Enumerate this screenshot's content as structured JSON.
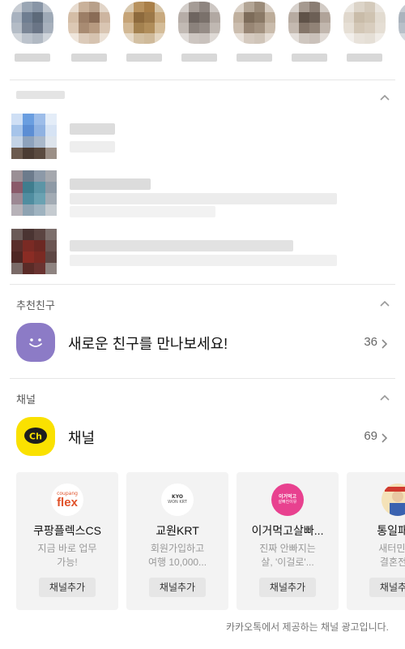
{
  "sections": {
    "birthday": {
      "title": "추천친구"
    },
    "recommended": {
      "title": "추천친구",
      "item_label": "새로운 친구를 만나보세요!",
      "count": "36",
      "icon": "smile-face-icon",
      "icon_color": "#8c7bc6"
    },
    "channels": {
      "title": "채널",
      "item_label": "채널",
      "count": "69",
      "icon": "kakao-channel-icon",
      "icon_color": "#fae100",
      "icon_text": "Ch"
    }
  },
  "channel_cards": [
    {
      "title": "쿠팡플렉스CS",
      "desc": "지금 바로 업무\n가능!",
      "button": "채널추가",
      "logo_top": "coupang",
      "logo_main": "flex"
    },
    {
      "title": "교원KRT",
      "desc": "회원가입하고\n여행 10,000...",
      "button": "채널추가",
      "logo_top": "KYO",
      "logo_main": "WON KRT"
    },
    {
      "title": "이거먹고살빠...",
      "desc": "진짜 안빠지는\n살, '이걸로'...",
      "button": "채널추가",
      "logo_top": "이거먹고",
      "logo_main": "살빠진이유"
    },
    {
      "title": "통일패밀",
      "desc": "새터민 남\n결혼전문",
      "button": "채널추가",
      "logo_top": "",
      "logo_main": ""
    }
  ],
  "footer_note": "카카오톡에서 제공하는 채널 광고입니다.",
  "colors": {
    "divider": "#e6e6e6",
    "card_bg": "#f3f3f3",
    "button_bg": "#e6e6e6",
    "muted_text": "#999999"
  }
}
